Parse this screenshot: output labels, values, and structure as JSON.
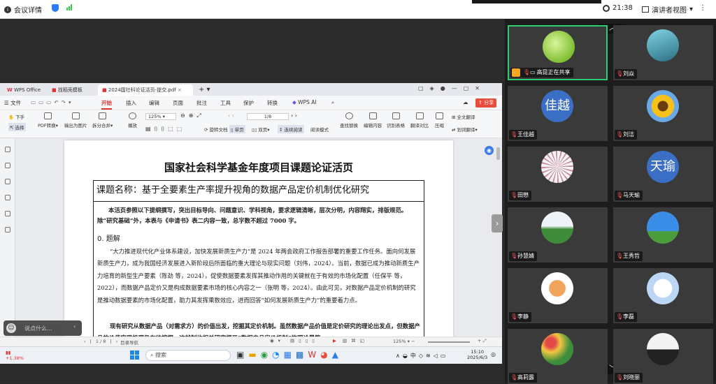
{
  "topbar": {
    "meeting_info": "会议详情",
    "time": "21:38",
    "view_mode": "演讲者视图"
  },
  "wps": {
    "tabs": [
      {
        "label": "WPS Office"
      },
      {
        "label": "找稻壳模板"
      },
      {
        "label": "2024国社科论证活页-提交.pdf"
      }
    ],
    "menu": [
      "文件",
      "开始",
      "插入",
      "编辑",
      "页面",
      "批注",
      "工具",
      "保护",
      "转换",
      "WPS AI"
    ],
    "share_label": "分享",
    "ribbon": {
      "hand": "下手",
      "select": "选择",
      "pdf_convert": "PDF转换",
      "export_image": "输出为图片",
      "split_merge": "拆分合并",
      "play": "播放",
      "zoom": "125%",
      "page": "1/8",
      "rotate": "旋转文档",
      "single": "单页",
      "double": "双页",
      "continuous": "连续阅读",
      "read_mode": "阅读模式",
      "find_replace": "查找替换",
      "edit_content": "编辑内容",
      "recognize_table": "识别表格",
      "translate_compare": "翻译对比",
      "compress": "压缩",
      "full_translate": "全文翻译",
      "smart_translate": "划词翻译"
    },
    "document": {
      "title": "国家社会科学基金年度项目课题论证活页",
      "project_name": "课题名称：基于全要素生产率提升视角的数据产品定价机制优化研究",
      "instructions": "本活页参照以下提纲撰写，突出目标导向、问题意识、学科视角，要求逻辑清晰，层次分明，内容翔实，排版规范。除“研究基础”外，本表与《申请书》表二内容一致，总字数不超过 7000 字。",
      "section_heading": "0. 题解",
      "para1": "“大力推进现代化产业体系建设，加快发展新质生产力”是 2024 年两会政府工作报告部署的重要工作任务。面向何发展新质生产力，成为我国经济发展进入新阶段后所面临的重大理论与现实问题（刘伟，2024）。当前，数据已成为推动新质生产力培育的新型生产要素（陈劲 等，2024），促使数据要素发挥其推动作用的关键就在于有效的市场化配置（任保平 等，2022），而数据产品定价又是构成数据要素市场的核心内容之一（张明 等，2024）。由此可见，对数据产品定价机制的研究是推动数据要素的市场化配置，助力其发挥乘数效应，进而回答“如何发展新质生产力”的重要着力点。",
      "para2": "现有研究从数据产品（对需求方）的价值出发，挖掘其定价机制。虽然数据产品价值是定价研究的理论出发点，但数据产品的价值实现机理仍有待挖掘，这就制约相关研究揭开“数据产品定价机制”的理论黑箱。"
    },
    "statusbar": {
      "page_nav": "1/8",
      "outline": "目录导航",
      "zoom": "125%"
    },
    "taskbar": {
      "search": "搜索",
      "ime": "中",
      "clock_time": "15:10",
      "clock_date": "2025/6/3",
      "stock": "+1.38%"
    }
  },
  "chat": {
    "placeholder": "说点什么..."
  },
  "participants": [
    {
      "name": "高昆正在共享",
      "avatar": "lime",
      "sharing": true
    },
    {
      "name": "刘焱",
      "avatar": "anime"
    },
    {
      "name": "王佳越",
      "avatar_text": "佳越",
      "color": "#3b6fc5"
    },
    {
      "name": "刘洁",
      "avatar": "sunflower"
    },
    {
      "name": "田懋",
      "avatar": "umbrella"
    },
    {
      "name": "马天瑜",
      "avatar_text": "天瑜",
      "color": "#3b6fc5"
    },
    {
      "name": "孙慧婧",
      "avatar": "field"
    },
    {
      "name": "王秀哲",
      "avatar": "sky"
    },
    {
      "name": "李静",
      "avatar": "tiger"
    },
    {
      "name": "李磊",
      "avatar": "rabbit"
    },
    {
      "name": "高莉露",
      "avatar": "flowers"
    },
    {
      "name": "刘晓丽",
      "avatar": "person"
    }
  ]
}
